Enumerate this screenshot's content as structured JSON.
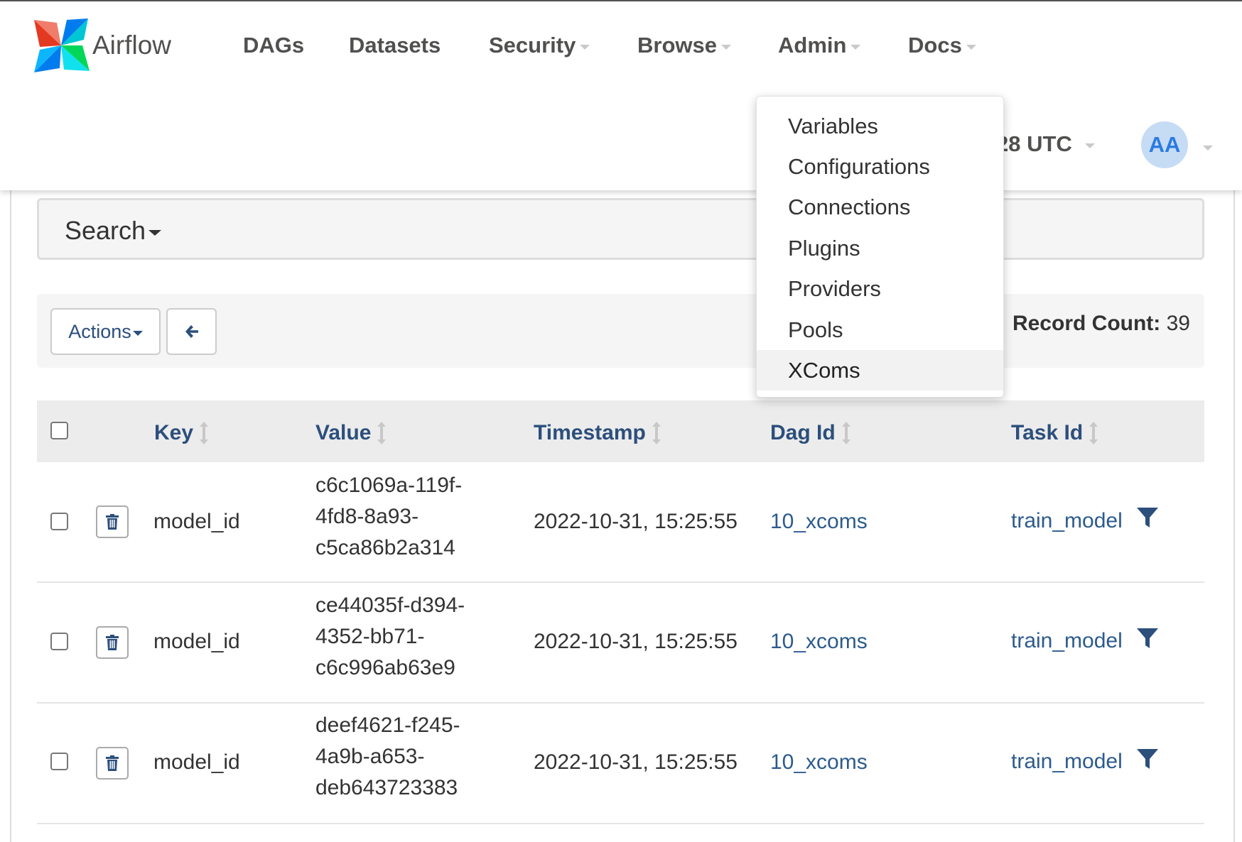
{
  "brand": {
    "name": "Airflow"
  },
  "nav": {
    "items": [
      {
        "label": "DAGs",
        "has_caret": false
      },
      {
        "label": "Datasets",
        "has_caret": false
      },
      {
        "label": "Security",
        "has_caret": true
      },
      {
        "label": "Browse",
        "has_caret": true
      },
      {
        "label": "Admin",
        "has_caret": true
      },
      {
        "label": "Docs",
        "has_caret": true
      }
    ],
    "time_text": "28 UTC",
    "avatar_initials": "AA"
  },
  "admin_menu": {
    "items": [
      "Variables",
      "Configurations",
      "Connections",
      "Plugins",
      "Providers",
      "Pools",
      "XComs"
    ],
    "active": "XComs"
  },
  "search": {
    "label": "Search"
  },
  "toolbar": {
    "actions_label": "Actions",
    "back_icon": "arrow-left-icon",
    "record_count_label": "Record Count:",
    "record_count": "39"
  },
  "table": {
    "headers": [
      "Key",
      "Value",
      "Timestamp",
      "Dag Id",
      "Task Id"
    ],
    "rows": [
      {
        "key": "model_id",
        "value_lines": [
          "c6c1069a-119f-",
          "4fd8-8a93-",
          "c5ca86b2a314"
        ],
        "timestamp": "2022-10-31, 15:25:55",
        "dag_id": "10_xcoms",
        "task_id": "train_model"
      },
      {
        "key": "model_id",
        "value_lines": [
          "ce44035f-d394-",
          "4352-bb71-",
          "c6c996ab63e9"
        ],
        "timestamp": "2022-10-31, 15:25:55",
        "dag_id": "10_xcoms",
        "task_id": "train_model"
      },
      {
        "key": "model_id",
        "value_lines": [
          "deef4621-f245-",
          "4a9b-a653-",
          "deb643723383"
        ],
        "timestamp": "2022-10-31, 15:25:55",
        "dag_id": "10_xcoms",
        "task_id": "train_model"
      }
    ]
  },
  "colors": {
    "link": "#2c5b8e",
    "header_text": "#2c4f7c",
    "avatar_bg": "#c6dcf5",
    "avatar_text": "#2d7be0"
  }
}
